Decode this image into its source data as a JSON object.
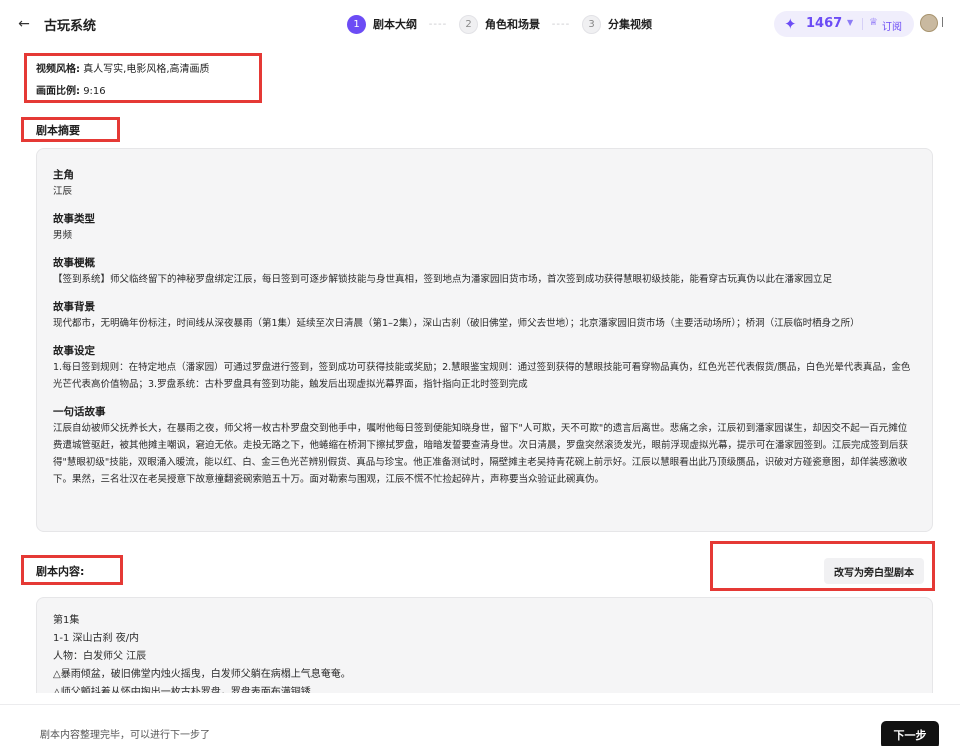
{
  "header": {
    "back_icon": "←",
    "title": "古玩系统",
    "steps": [
      {
        "num": "1",
        "label": "剧本大纲"
      },
      {
        "num": "2",
        "label": "角色和场景"
      },
      {
        "num": "3",
        "label": "分集视频"
      }
    ],
    "step_separator": "----",
    "credits": "1467",
    "subscribe_label": "订阅"
  },
  "meta": {
    "style_key": "视频风格:",
    "style_value": "真人写实,电影风格,高清画质",
    "ratio_key": "画面比例:",
    "ratio_value": "9:16"
  },
  "summary": {
    "section_title": "剧本摘要",
    "blocks": [
      {
        "title": "主角",
        "body": "江辰"
      },
      {
        "title": "故事类型",
        "body": "男频"
      },
      {
        "title": "故事梗概",
        "body": "【签到系统】师父临终留下的神秘罗盘绑定江辰，每日签到可逐步解锁技能与身世真相，签到地点为潘家园旧货市场，首次签到成功获得慧眼初级技能，能看穿古玩真伪以此在潘家园立足"
      },
      {
        "title": "故事背景",
        "body": "现代都市，无明确年份标注，时间线从深夜暴雨（第1集）延续至次日清晨（第1–2集），深山古刹（破旧佛堂，师父去世地）；北京潘家园旧货市场（主要活动场所）；桥洞（江辰临时栖身之所）"
      },
      {
        "title": "故事设定",
        "body": "1.每日签到规则：在特定地点（潘家园）可通过罗盘进行签到，签到成功可获得技能或奖励；2.慧眼鉴宝规则：通过签到获得的慧眼技能可看穿物品真伪，红色光芒代表假货/赝品，白色光晕代表真品，金色光芒代表高价值物品；3.罗盘系统：古朴罗盘具有签到功能，触发后出现虚拟光幕界面，指针指向正北时签到完成"
      },
      {
        "title": "一句话故事",
        "body": "江辰自幼被师父抚养长大，在暴雨之夜，师父将一枚古朴罗盘交到他手中，嘱咐他每日签到便能知晓身世，留下\"人可欺，天不可欺\"的遗言后离世。悲痛之余，江辰初到潘家园谋生，却因交不起一百元摊位费遭城管驱赶，被其他摊主嘲讽，窘迫无依。走投无路之下，他蜷缩在桥洞下擦拭罗盘，暗暗发誓要查清身世。次日清晨，罗盘突然滚烫发光，眼前浮现虚拟光幕，提示可在潘家园签到。江辰完成签到后获得\"慧眼初级\"技能，双眼涌入暖流，能以红、白、金三色光芒辨别假货、真品与珍宝。他正准备测试时，隔壁摊主老吴持青花碗上前示好。江辰以慧眼看出此乃顶级赝品，识破对方碰瓷意图，却佯装感激收下。果然，三名壮汉在老吴授意下故意撞翻瓷碗索赔五十万。面对勒索与围观，江辰不慌不忙捡起碎片，声称要当众验证此碗真伪。"
      }
    ]
  },
  "content": {
    "section_title": "剧本内容:",
    "rewrite_label": "改写为旁白型剧本",
    "lines": [
      "第1集",
      "1-1 深山古刹 夜/内",
      "人物：白发师父 江辰",
      "△暴雨倾盆，破旧佛堂内烛火摇曳，白发师父躺在病榻上气息奄奄。",
      "△师父颤抖着从怀中掏出一枚古朴罗盘，罗盘表面布满铜锈"
    ]
  },
  "footer": {
    "status_text": "剧本内容整理完毕，可以进行下一步了",
    "next_label": "下一步"
  },
  "colors": {
    "accent": "#6c4cf5",
    "highlight_box": "#e53935"
  }
}
